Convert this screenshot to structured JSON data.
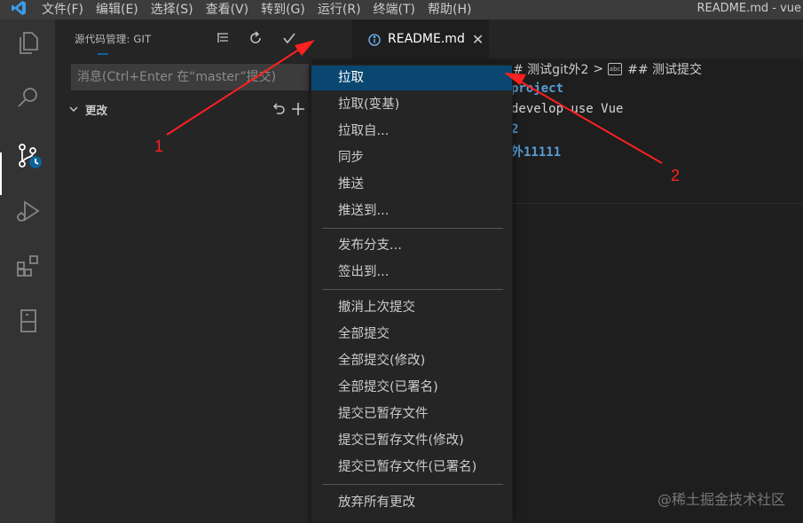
{
  "menubar": {
    "items": [
      "文件(F)",
      "编辑(E)",
      "选择(S)",
      "查看(V)",
      "转到(G)",
      "运行(R)",
      "终端(T)",
      "帮助(H)"
    ],
    "window_title": "README.md - vue"
  },
  "sidebar": {
    "header": "源代码管理: GIT",
    "message_placeholder": "消息(Ctrl+Enter 在“master”提交)",
    "changes_label": "更改"
  },
  "tab": {
    "name": "README.md",
    "close": "✕"
  },
  "editor": {
    "breadcrumb": {
      "part1": "# 测试git外2",
      "separator": ">",
      "part2": "## 测试提交"
    },
    "lines": [
      "project",
      "develop use Vue",
      "2",
      "外11111"
    ]
  },
  "context_menu": {
    "groups": [
      [
        "拉取",
        "拉取(变基)",
        "拉取自...",
        "同步",
        "推送",
        "推送到..."
      ],
      [
        "发布分支...",
        "签出到..."
      ],
      [
        "撤消上次提交",
        "全部提交",
        "全部提交(修改)",
        "全部提交(已署名)",
        "提交已暂存文件",
        "提交已暂存文件(修改)",
        "提交已暂存文件(已署名)"
      ],
      [
        "放弃所有更改"
      ]
    ],
    "selected": "拉取"
  },
  "annotations": {
    "label1": "1",
    "label2": "2",
    "color": "#ff2020"
  },
  "watermark": "@稀土掘金技术社区",
  "colors": {
    "accent": "#094771",
    "activity_bar": "#333333",
    "sidebar": "#252526",
    "editor": "#1e1e1e"
  }
}
